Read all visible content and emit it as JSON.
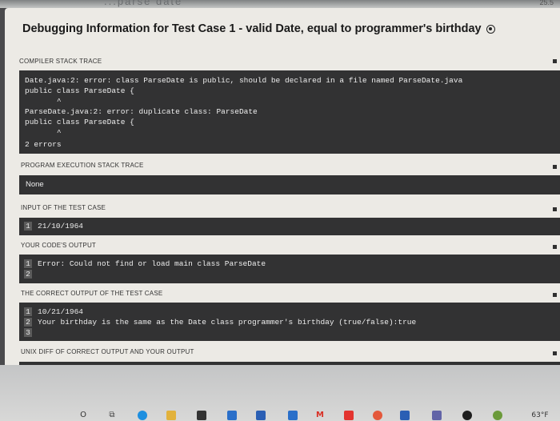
{
  "header": {
    "title": "Debugging Information for Test Case 1 - valid Date, equal to programmer's birthday",
    "background_title": "...parse date",
    "corner_number": "25.5"
  },
  "sections": {
    "compiler": {
      "label": "COMPILER STACK TRACE",
      "lines": [
        "Date.java:2: error: class ParseDate is public, should be declared in a file named ParseDate.java",
        "public class ParseDate {",
        "       ^",
        "ParseDate.java:2: error: duplicate class: ParseDate",
        "public class ParseDate {",
        "       ^",
        "2 errors"
      ]
    },
    "execution": {
      "label": "PROGRAM EXECUTION STACK TRACE",
      "text": "None"
    },
    "input": {
      "label": "INPUT OF THE TEST CASE",
      "rows": [
        {
          "num": "1",
          "text": "21/10/1964"
        }
      ]
    },
    "your_output": {
      "label": "YOUR CODE'S OUTPUT",
      "rows": [
        {
          "num": "1",
          "text": "Error: Could not find or load main class ParseDate"
        },
        {
          "num": "2",
          "text": ""
        }
      ]
    },
    "correct_output": {
      "label": "THE CORRECT OUTPUT OF THE TEST CASE",
      "rows": [
        {
          "num": "1",
          "text": "10/21/1964"
        },
        {
          "num": "2",
          "text": "Your birthday is the same as the Date class programmer's birthday (true/false):true"
        },
        {
          "num": "3",
          "text": ""
        }
      ]
    },
    "diff": {
      "label": "UNIX DIFF  OF CORRECT OUTPUT AND YOUR OUTPUT"
    }
  },
  "taskbar": {
    "icons": [
      "search-icon",
      "task-view-icon",
      "chrome-icon",
      "file-explorer-icon",
      "store-icon",
      "mail-icon",
      "word-icon",
      "gmail-icon",
      "acrobat-icon",
      "chrome-icon",
      "word-icon",
      "teams-icon",
      "onedrive-icon",
      "windows-icon"
    ],
    "tray_text": "63°F",
    "colors": {
      "word": "#2b5fb4",
      "gmail": "#d93025",
      "acrobat": "#e3342f",
      "teams": "#6264a7"
    }
  }
}
